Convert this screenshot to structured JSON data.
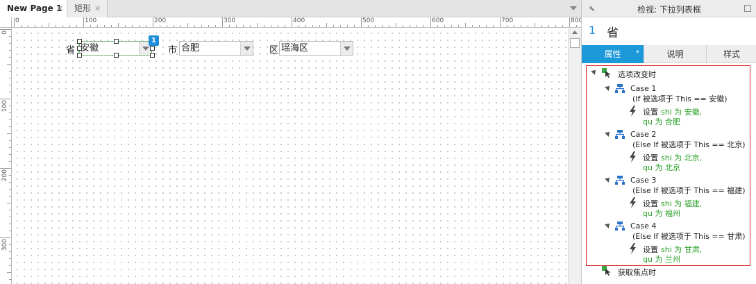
{
  "tabs": [
    {
      "label": "New Page 1",
      "close": "✕"
    },
    {
      "label": "矩形",
      "close": "✕"
    }
  ],
  "ruler": {
    "h_labels": [
      "0",
      "100",
      "200",
      "300",
      "400",
      "500",
      "600",
      "700",
      "800"
    ],
    "v_labels": [
      "0",
      "100",
      "200",
      "300"
    ]
  },
  "canvas": {
    "province": {
      "label": "省",
      "value": "安徽",
      "badge": "1"
    },
    "city": {
      "label": "市",
      "value": "合肥"
    },
    "district": {
      "label": "区",
      "value": "瑶海区"
    }
  },
  "panel": {
    "title": "检视: 下拉列表框",
    "widget_number": "1",
    "widget_name": "省",
    "tabs": [
      {
        "label": "属性",
        "marker": "*"
      },
      {
        "label": "说明"
      },
      {
        "label": "样式"
      }
    ],
    "event": {
      "name": "选项改变时"
    },
    "cases": [
      {
        "name": "Case 1",
        "condition": "(If 被选项于 This == 安徽)",
        "action_prefix": "设置",
        "shi_text": "shi 为 安徽,",
        "qu_text": "qu 为 合肥"
      },
      {
        "name": "Case 2",
        "condition": "(Else If 被选项于 This == 北京)",
        "action_prefix": "设置",
        "shi_text": "shi 为 北京,",
        "qu_text": "qu 为 北京"
      },
      {
        "name": "Case 3",
        "condition": "(Else If 被选项于 This == 福建)",
        "action_prefix": "设置",
        "shi_text": "shi 为 福建,",
        "qu_text": "qu 为 福州"
      },
      {
        "name": "Case 4",
        "condition": "(Else If 被选项于 This == 甘肃)",
        "action_prefix": "设置",
        "shi_text": "shi 为 甘肃,",
        "qu_text": "qu 为 兰州"
      }
    ],
    "next_event": {
      "name": "获取焦点时"
    }
  },
  "colors": {
    "accent": "#1b99d9",
    "badge": "#1e8fd8",
    "highlight_border": "#d62c2c",
    "variable_text": "#28a028"
  }
}
